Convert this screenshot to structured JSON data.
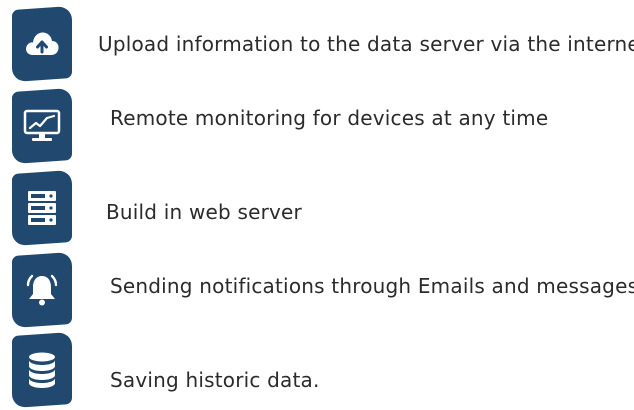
{
  "features": [
    {
      "icon": "cloud-upload-icon",
      "text": "Upload information to the data server via the internet"
    },
    {
      "icon": "monitor-chart-icon",
      "text": "Remote monitoring for devices at any time"
    },
    {
      "icon": "server-rack-icon",
      "text": "Build in web server"
    },
    {
      "icon": "bell-icon",
      "text": "Sending notifications through Emails and messages"
    },
    {
      "icon": "database-icon",
      "text": "Saving historic data."
    }
  ],
  "colors": {
    "badge": "#21496f",
    "text": "#2b2b2b",
    "icon": "#ffffff"
  }
}
